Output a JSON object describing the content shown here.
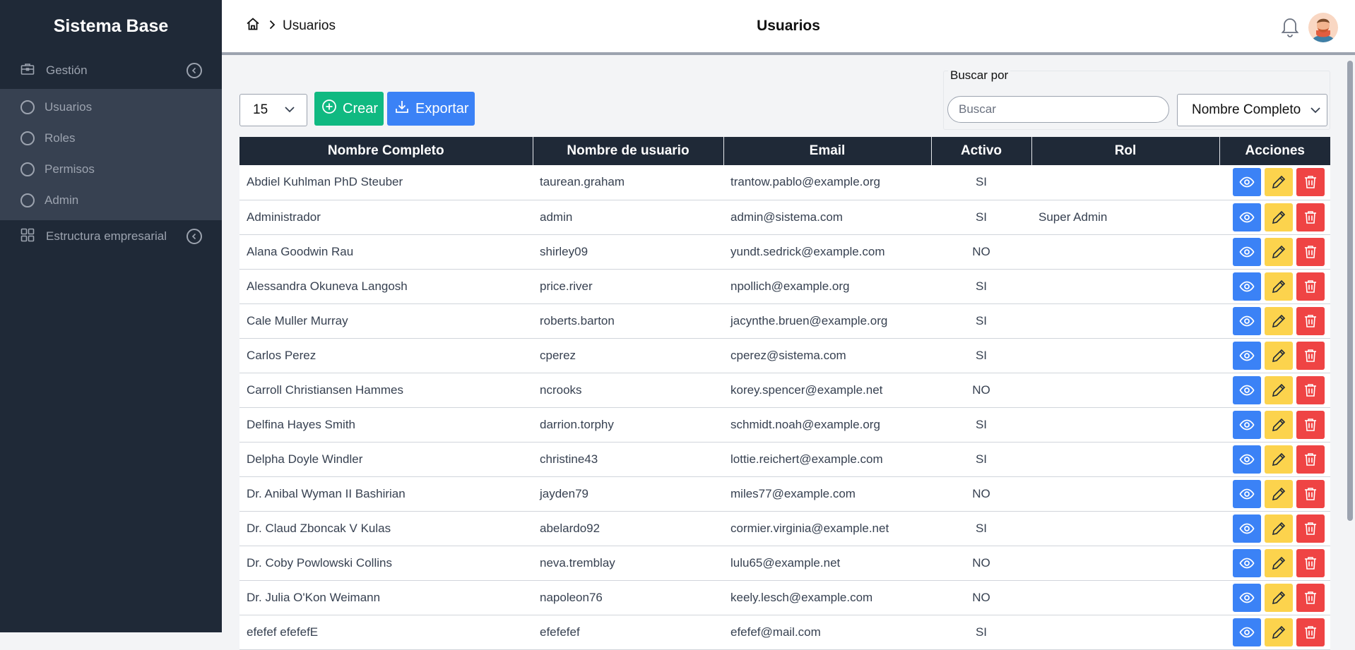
{
  "sidebar": {
    "brand": "Sistema Base",
    "groups": [
      {
        "label": "Gestión",
        "items": [
          "Usuarios",
          "Roles",
          "Permisos",
          "Admin"
        ]
      },
      {
        "label": "Estructura empresarial"
      }
    ]
  },
  "header": {
    "breadcrumb": "Usuarios",
    "title": "Usuarios"
  },
  "toolbar": {
    "per_page": "15",
    "create_label": "Crear",
    "export_label": "Exportar",
    "search_legend": "Buscar por",
    "search_placeholder": "Buscar",
    "search_field": "Nombre Completo"
  },
  "table": {
    "columns": [
      "Nombre Completo",
      "Nombre de usuario",
      "Email",
      "Activo",
      "Rol",
      "Acciones"
    ],
    "rows": [
      [
        "Abdiel Kuhlman PhD Steuber",
        "taurean.graham",
        "trantow.pablo@example.org",
        "SI",
        ""
      ],
      [
        "Administrador",
        "admin",
        "admin@sistema.com",
        "SI",
        "Super Admin"
      ],
      [
        "Alana Goodwin Rau",
        "shirley09",
        "yundt.sedrick@example.com",
        "NO",
        ""
      ],
      [
        "Alessandra Okuneva Langosh",
        "price.river",
        "npollich@example.org",
        "SI",
        ""
      ],
      [
        "Cale Muller Murray",
        "roberts.barton",
        "jacynthe.bruen@example.org",
        "SI",
        ""
      ],
      [
        "Carlos Perez",
        "cperez",
        "cperez@sistema.com",
        "SI",
        ""
      ],
      [
        "Carroll Christiansen Hammes",
        "ncrooks",
        "korey.spencer@example.net",
        "NO",
        ""
      ],
      [
        "Delfina Hayes Smith",
        "darrion.torphy",
        "schmidt.noah@example.org",
        "SI",
        ""
      ],
      [
        "Delpha Doyle Windler",
        "christine43",
        "lottie.reichert@example.com",
        "SI",
        ""
      ],
      [
        "Dr. Anibal Wyman II Bashirian",
        "jayden79",
        "miles77@example.com",
        "NO",
        ""
      ],
      [
        "Dr. Claud Zboncak V Kulas",
        "abelardo92",
        "cormier.virginia@example.net",
        "SI",
        ""
      ],
      [
        "Dr. Coby Powlowski Collins",
        "neva.tremblay",
        "lulu65@example.net",
        "NO",
        ""
      ],
      [
        "Dr. Julia O'Kon Weimann",
        "napoleon76",
        "keely.lesch@example.com",
        "NO",
        ""
      ],
      [
        "efefef efefefE",
        "efefefef",
        "efefef@mail.com",
        "SI",
        ""
      ]
    ]
  },
  "colors": {
    "sidebar_bg": "#1f2937",
    "sidebar_sub_bg": "#374151",
    "create": "#10b981",
    "export": "#3b82f6",
    "view": "#3b82f6",
    "edit": "#fcd34d",
    "delete": "#ef4444"
  }
}
